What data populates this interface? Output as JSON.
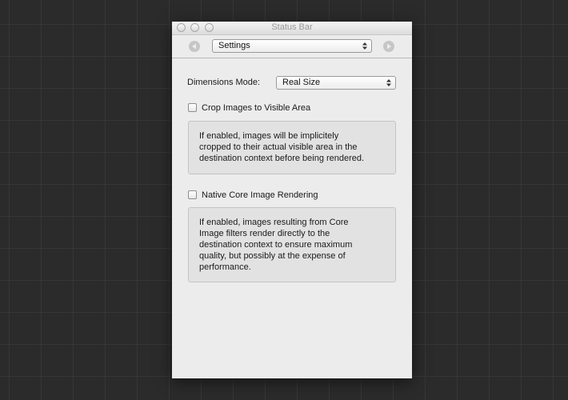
{
  "window": {
    "title": "Status Bar"
  },
  "toolbar": {
    "selected_panel": "Settings",
    "back_icon": "chevron-left-icon",
    "forward_icon": "chevron-right-icon"
  },
  "settings": {
    "dimensions_label": "Dimensions Mode:",
    "dimensions_value": "Real Size",
    "crop_label": "Crop Images to Visible Area",
    "crop_checked": false,
    "crop_description": [
      "If enabled, images will be implicitely",
      "cropped to their actual visible area in the",
      "destination context before being rendered."
    ],
    "native_label": "Native Core Image Rendering",
    "native_checked": false,
    "native_description": [
      "If enabled, images resulting from Core",
      "Image filters render directly to the",
      "destination context to ensure maximum",
      "quality, but possibly at the expense of",
      "performance."
    ]
  },
  "colors": {
    "background": "#2b2b2b",
    "window": "#ececec",
    "description_box": "#e2e2e2"
  }
}
